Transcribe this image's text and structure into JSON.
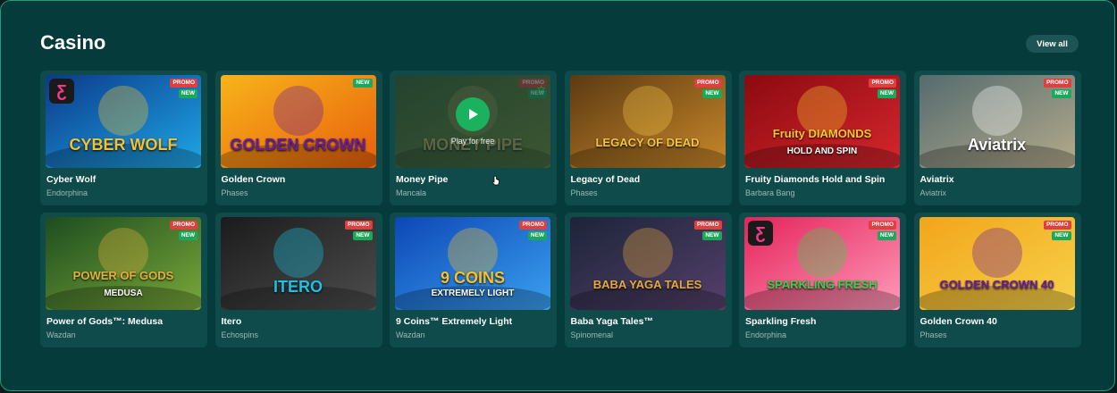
{
  "section": {
    "title": "Casino",
    "view_all_label": "View all"
  },
  "games": [
    {
      "name": "Cyber Wolf",
      "provider": "Endorphina",
      "badges": [
        "PROMO",
        "NEW"
      ],
      "thumb_text": "CYBER WOLF",
      "bg1": "#0b3a8a",
      "bg2": "#1fa7e6",
      "accent": "#f1c232",
      "logo": "Ƹ"
    },
    {
      "name": "Golden Crown",
      "provider": "Phases",
      "badges": [
        "NEW"
      ],
      "thumb_text": "GOLDEN CROWN",
      "bg1": "#f7b41a",
      "bg2": "#e85f0c",
      "accent": "#6a1b9a"
    },
    {
      "name": "Money Pipe",
      "provider": "Mancala",
      "badges": [
        "PROMO",
        "NEW"
      ],
      "thumb_text": "MONEY PIPE",
      "bg1": "#3c5a32",
      "bg2": "#7b8e3a",
      "accent": "#c8b56a",
      "hover": true,
      "play_label": "Play for free"
    },
    {
      "name": "Legacy of Dead",
      "provider": "Phases",
      "badges": [
        "PROMO",
        "NEW"
      ],
      "thumb_text": "LEGACY OF DEAD",
      "bg1": "#5c3a12",
      "bg2": "#c9882a",
      "accent": "#f3c547"
    },
    {
      "name": "Fruity Diamonds Hold and Spin",
      "provider": "Barbara Bang",
      "badges": [
        "PROMO",
        "NEW"
      ],
      "thumb_text": "Fruity DIAMONDS",
      "bg1": "#8b0a10",
      "bg2": "#d6262d",
      "accent": "#f7c62f",
      "extra": "HOLD AND SPIN"
    },
    {
      "name": "Aviatrix",
      "provider": "Aviatrix",
      "badges": [
        "PROMO",
        "NEW"
      ],
      "thumb_text": "Aviatrix",
      "bg1": "#556b6e",
      "bg2": "#b4aa8c",
      "accent": "#ffffff"
    },
    {
      "name": "Power of Gods™: Medusa",
      "provider": "Wazdan",
      "badges": [
        "PROMO",
        "NEW"
      ],
      "thumb_text": "POWER OF GODS",
      "bg1": "#1d4d1f",
      "bg2": "#7aa83a",
      "accent": "#e3b23c",
      "extra": "MEDUSA"
    },
    {
      "name": "Itero",
      "provider": "Echospins",
      "badges": [
        "PROMO",
        "NEW"
      ],
      "thumb_text": "ITERO",
      "bg1": "#1b1b1b",
      "bg2": "#4d4d4d",
      "accent": "#19c3e8"
    },
    {
      "name": "9 Coins™ Extremely Light",
      "provider": "Wazdan",
      "badges": [
        "PROMO",
        "NEW"
      ],
      "thumb_text": "9 COINS",
      "bg1": "#0d47b5",
      "bg2": "#3aa0f0",
      "accent": "#f6c02a",
      "extra": "EXTREMELY LIGHT"
    },
    {
      "name": "Baba Yaga Tales™",
      "provider": "Spinomenal",
      "badges": [
        "PROMO",
        "NEW"
      ],
      "thumb_text": "BABA YAGA TALES",
      "bg1": "#1c2438",
      "bg2": "#55406b",
      "accent": "#e9a93a"
    },
    {
      "name": "Sparkling Fresh",
      "provider": "Endorphina",
      "badges": [
        "PROMO",
        "NEW"
      ],
      "thumb_text": "SPARKLING FRESH",
      "bg1": "#e5235b",
      "bg2": "#ff9ab9",
      "accent": "#3ad04d",
      "logo": "Ƹ"
    },
    {
      "name": "Golden Crown 40",
      "provider": "Phases",
      "badges": [
        "PROMO",
        "NEW"
      ],
      "thumb_text": "GOLDEN CROWN 40",
      "bg1": "#f2a51b",
      "bg2": "#f7d24a",
      "accent": "#6a1b9a"
    }
  ]
}
